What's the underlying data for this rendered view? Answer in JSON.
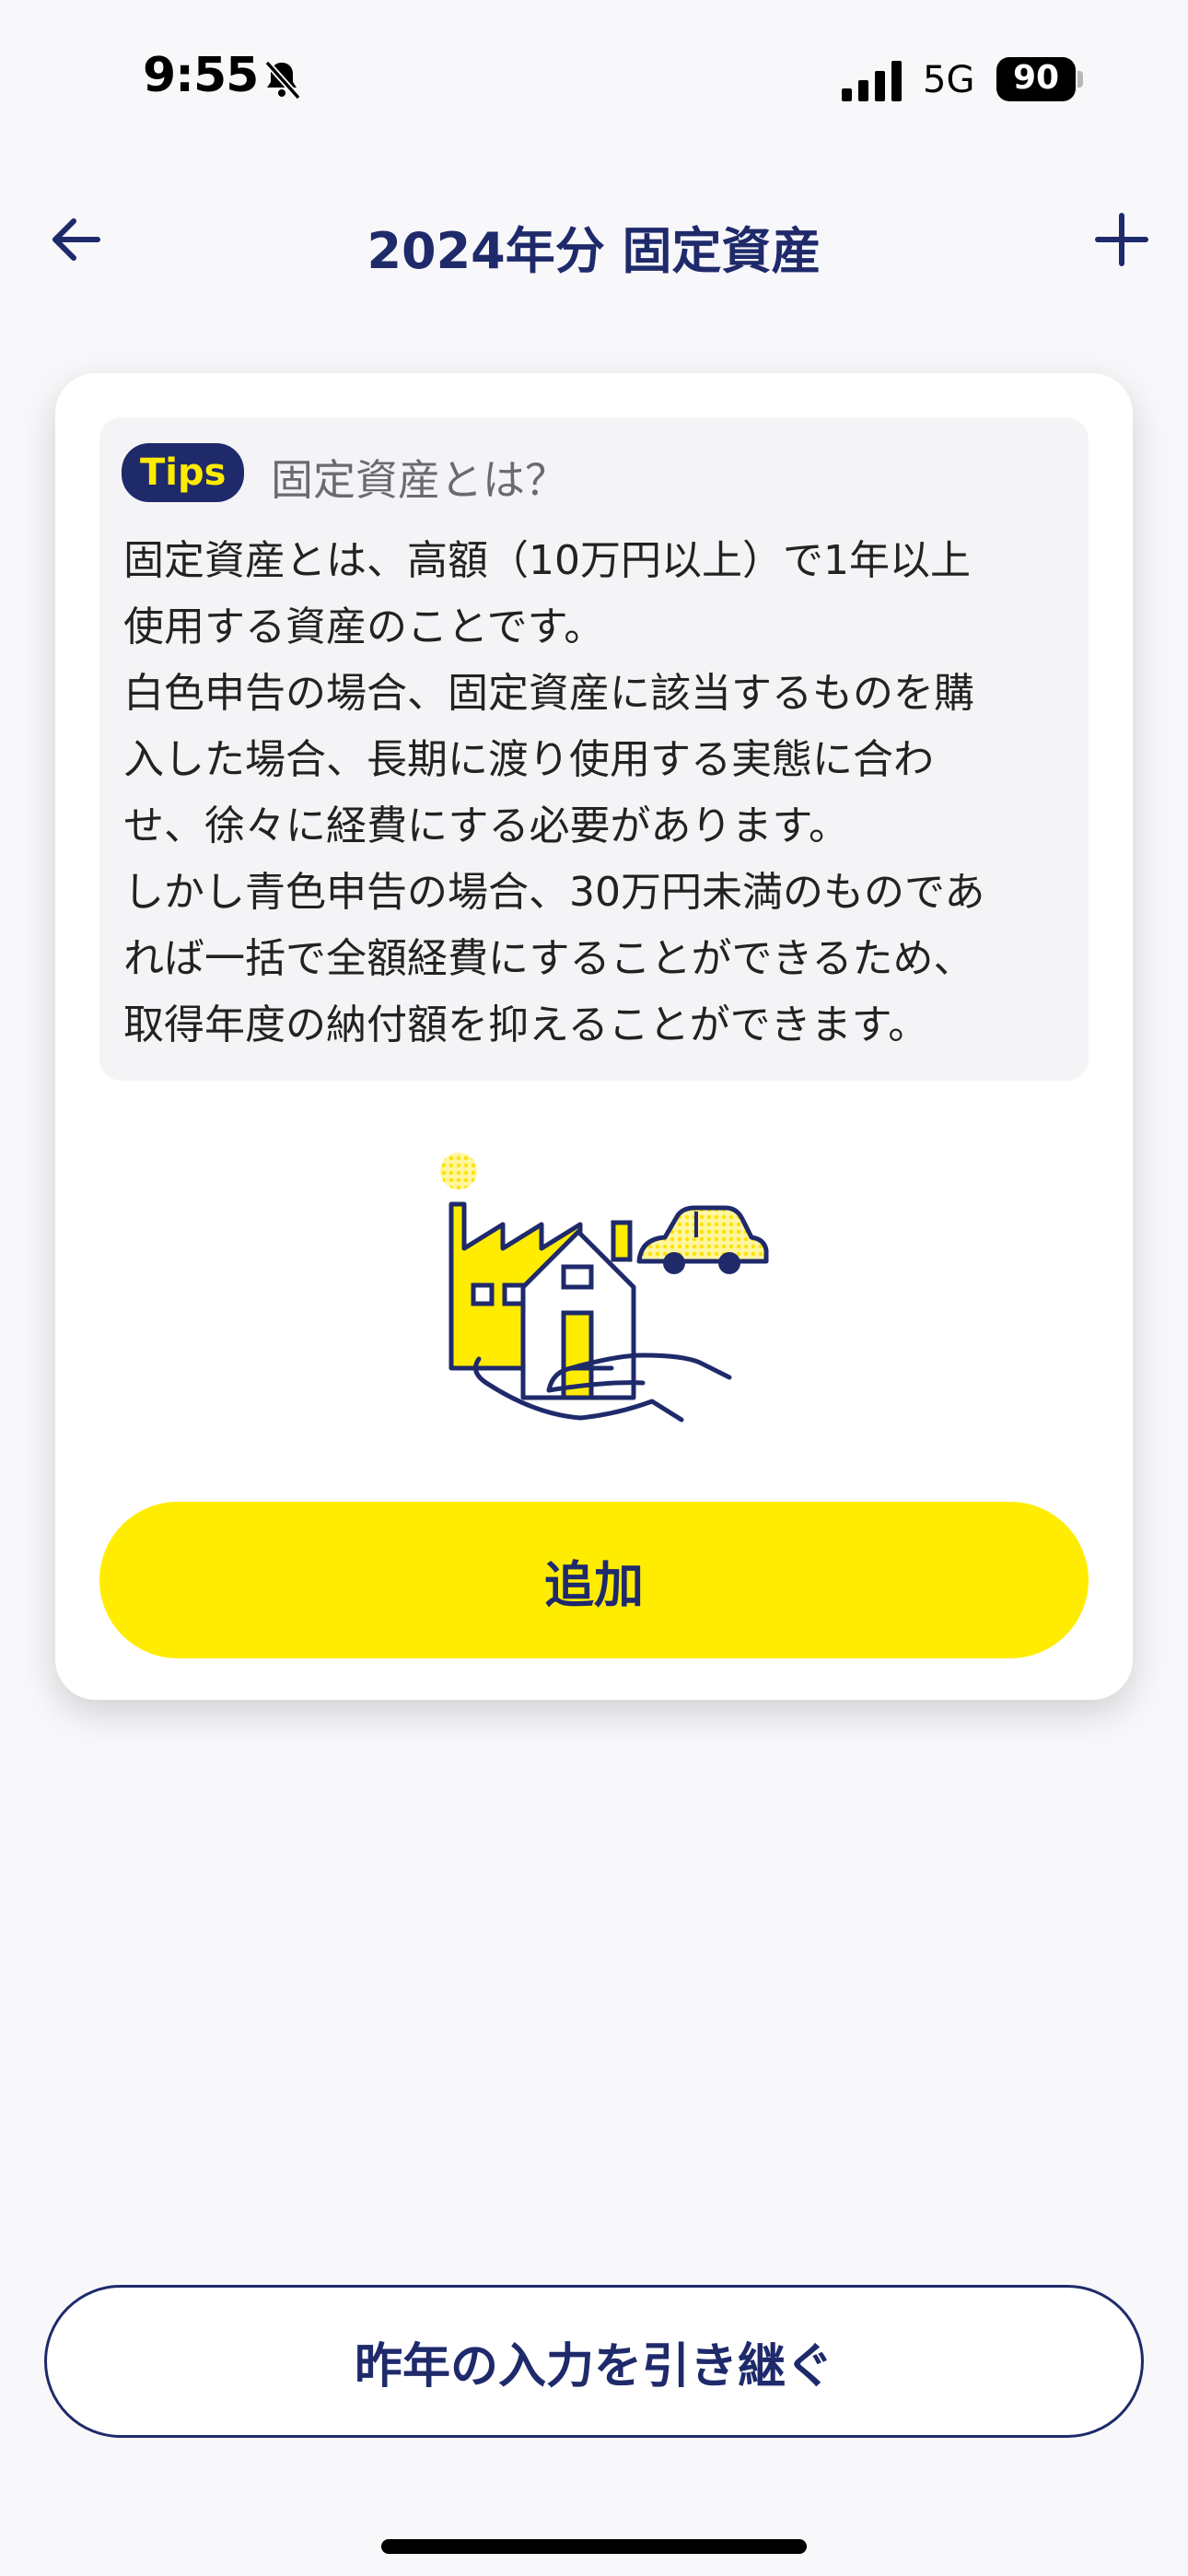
{
  "status_bar": {
    "time": "9:55",
    "network": "5G",
    "battery": "90"
  },
  "nav": {
    "title": "2024年分 固定資産"
  },
  "tips": {
    "badge": "Tips",
    "heading": "固定資産とは？",
    "body": "固定資産とは、高額（10万円以上）で1年以上\n使用する資産のことです。\n白色申告の場合、固定資産に該当するものを購\n入した場合、長期に渡り使用する実態に合わ\nせ、徐々に経費にする必要があります。\nしかし青色申告の場合、30万円未満のものであ\nれば一括で全額経費にすることができるため、\n取得年度の納付額を抑えることができます。"
  },
  "add_button": {
    "label": "追加"
  },
  "carry_over_button": {
    "label": "昨年の入力を引き継ぐ"
  },
  "colors": {
    "navy": "#1f2a6b",
    "accent_yellow": "#ffec00",
    "background": "#f8f8fa"
  },
  "icons": {
    "bell": "bell-slash-icon",
    "signal": "cellular-signal-icon",
    "back": "arrow-left-icon",
    "add": "plus-icon",
    "illustration": "assets-factory-house-car-hand-illustration"
  }
}
